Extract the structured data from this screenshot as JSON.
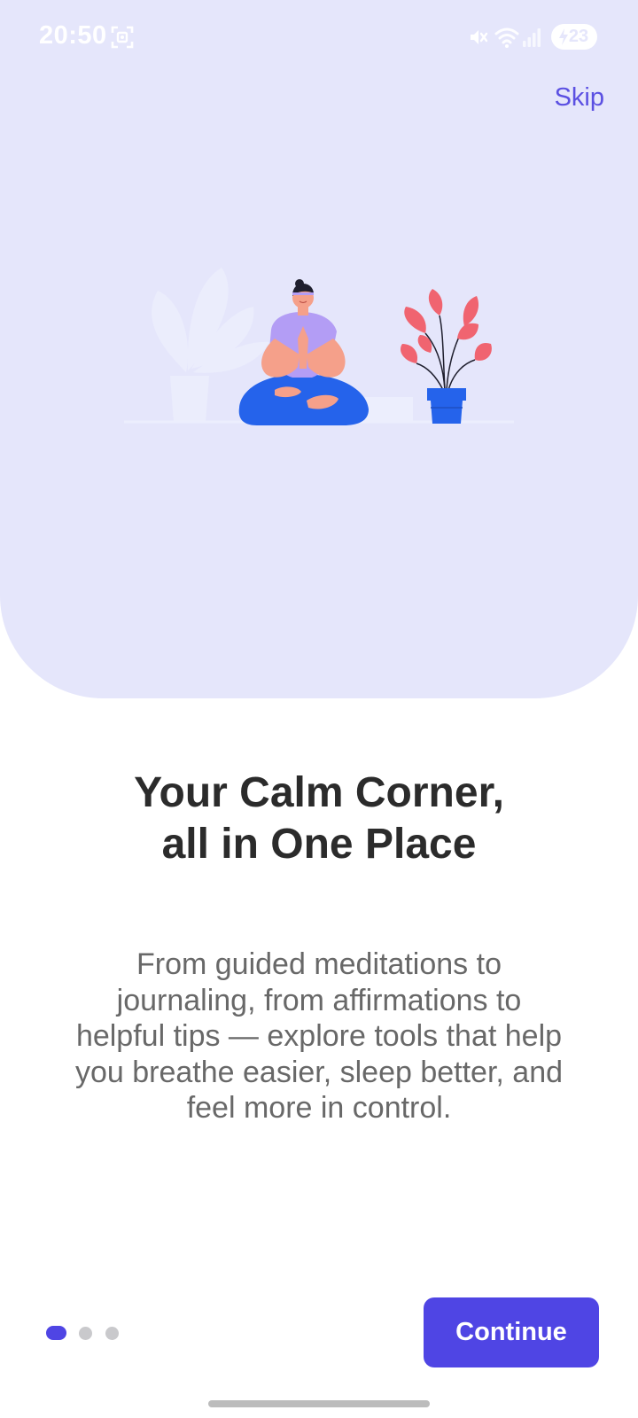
{
  "status_bar": {
    "time": "20:50",
    "battery": "23",
    "icons": [
      "screen-record-icon",
      "mute-icon",
      "wifi-icon",
      "signal-icon",
      "battery-icon"
    ]
  },
  "header": {
    "skip_label": "Skip"
  },
  "illustration": {
    "name": "meditation-illustration",
    "colors": {
      "background": "#e5e6fb",
      "shirt": "#b39df5",
      "pants": "#2563eb",
      "skin": "#f5a08a",
      "leaves": "#f06470",
      "pot": "#2563eb"
    }
  },
  "onboarding": {
    "title_lines": [
      "Your Calm Corner,",
      "all in One Place"
    ],
    "body_lines": [
      "From guided meditations to",
      "journaling, from affirmations to",
      "helpful tips — explore tools that help",
      "you breathe easier, sleep better, and",
      "feel more in control."
    ]
  },
  "pager": {
    "count": 3,
    "active_index": 0
  },
  "footer": {
    "continue_label": "Continue"
  },
  "colors": {
    "accent": "#4f45e4",
    "hero_background": "#e5e6fb",
    "title": "#2b2b2b",
    "body": "#686868",
    "dot_inactive": "#c9c9cc"
  }
}
